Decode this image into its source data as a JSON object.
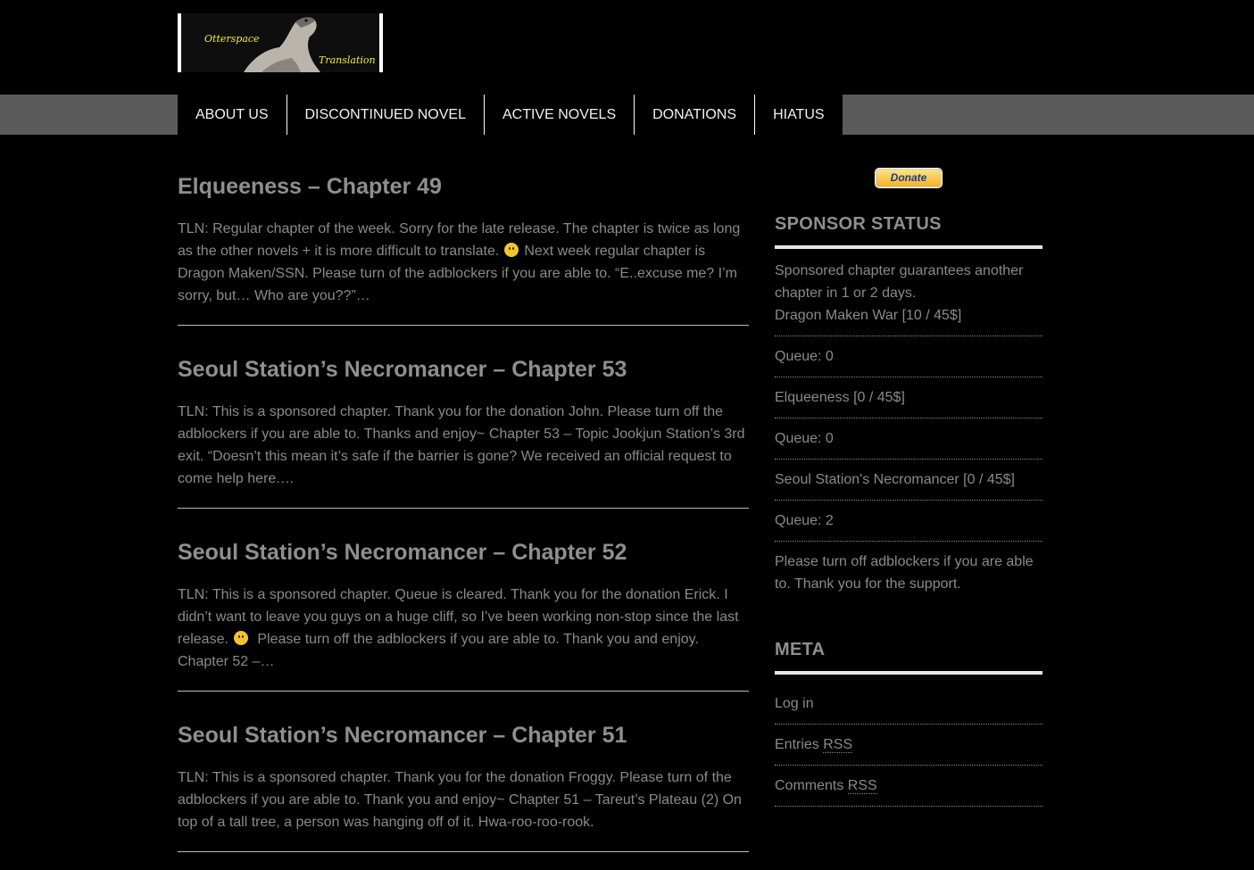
{
  "logo": {
    "text_line1": "Otterspace",
    "text_line2": "Translation"
  },
  "nav": {
    "items": [
      {
        "label": "ABOUT US"
      },
      {
        "label": "DISCONTINUED NOVEL"
      },
      {
        "label": "ACTIVE NOVELS"
      },
      {
        "label": "DONATIONS"
      },
      {
        "label": "HIATUS"
      }
    ]
  },
  "posts": [
    {
      "title": "Elqueeness – Chapter 49",
      "excerpt_part1": "TLN: Regular chapter of the week.  Sorry for the late release.  The chapter is twice as long as the other novels + it is more difficult to translate.",
      "excerpt_part2": "Next week regular chapter is Dragon Maken/SSN.  Please turn of the adblockers if you are able to. “E..excuse me? I’m sorry, but… Who are you??”…"
    },
    {
      "title": "Seoul Station’s Necromancer – Chapter 53",
      "excerpt": "TLN:  This is a sponsored chapter.  Thank you for the donation John.  Please turn off the adblockers if you are able to.  Thanks and enjoy~     Chapter 53 – Topic   Jookjun Station’s 3rd exit. “Doesn’t this mean it’s safe if the barrier is gone? We received an official request to come help here.…"
    },
    {
      "title": "Seoul Station’s Necromancer – Chapter 52",
      "excerpt_part1": "TLN: This is a sponsored chapter.    Queue is cleared. Thank you for the donation Erick.   I didn’t want to leave you guys on a huge cliff, so I’ve been working non-stop since the last release.",
      "excerpt_part2": "   Please turn off the adblockers if you are able to.  Thank  you and enjoy.   Chapter 52 –…"
    },
    {
      "title": "Seoul Station’s Necromancer – Chapter 51",
      "excerpt": "TLN: This is a sponsored chapter.  Thank you for the donation Froggy.  Please turn of the adblockers if you are able to.  Thank you and enjoy~   Chapter 51 – Tareut’s Plateau (2)   On top of a tall tree, a person was hanging off of it. Hwa-roo-roo-rook."
    }
  ],
  "sidebar": {
    "donate_label": "Donate",
    "sponsor": {
      "title": "SPONSOR STATUS",
      "intro_line1": "Sponsored chapter guarantees another chapter in 1 or 2 days.",
      "intro_line2": "Dragon Maken War [10 / 45$]",
      "items": [
        "Queue: 0",
        "Elqueeness [0 / 45$]",
        "Queue: 0",
        "Seoul Station's Necromancer [0 / 45$]",
        "Queue: 2",
        "Please turn off adblockers if you are able to. Thank you for the support."
      ]
    },
    "meta": {
      "title": "META",
      "login": "Log in",
      "entries_prefix": "Entries ",
      "entries_abbr": "RSS",
      "comments_prefix": "Comments ",
      "comments_abbr": "RSS"
    }
  },
  "colors": {
    "background": "#000000",
    "nav_bar": "#5a5a5a",
    "text": "#8a8a8a",
    "logo_text": "#f0ec3a",
    "donate_button": "#f5b128"
  }
}
